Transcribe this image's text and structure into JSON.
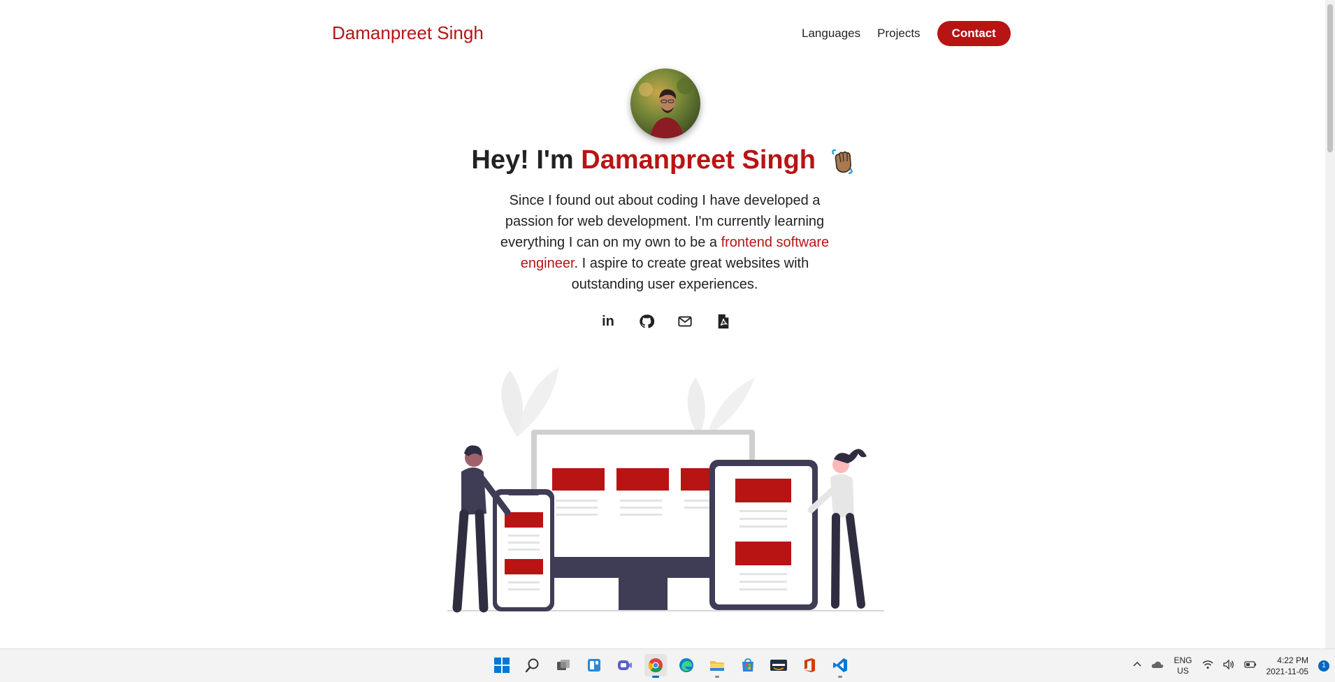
{
  "brand": "Damanpreet Singh",
  "nav": {
    "languages": "Languages",
    "projects": "Projects",
    "contact": "Contact"
  },
  "hero": {
    "greeting": "Hey! I'm ",
    "name": "Damanpreet Singh",
    "bio_part1": "Since I found out about coding I have developed a passion for web development. I'm currently learning everything I can on my own to be a ",
    "bio_highlight": "frontend software engineer",
    "bio_part2": ". I aspire to create great websites with outstanding user experiences."
  },
  "socials": {
    "linkedin": "in"
  },
  "colors": {
    "accent": "#b81414",
    "text": "#222222",
    "dark": "#3f3d56"
  },
  "taskbar": {
    "apps": [
      "start-icon",
      "search-icon",
      "task-view-icon",
      "widgets-icon",
      "chat-icon",
      "chrome-icon",
      "edge-icon",
      "file-explorer-icon",
      "store-icon",
      "amazon-icon",
      "office-icon",
      "vscode-icon"
    ],
    "lang_top": "ENG",
    "lang_bottom": "US",
    "time": "4:22 PM",
    "date": "2021-11-05",
    "notifications": "1"
  }
}
